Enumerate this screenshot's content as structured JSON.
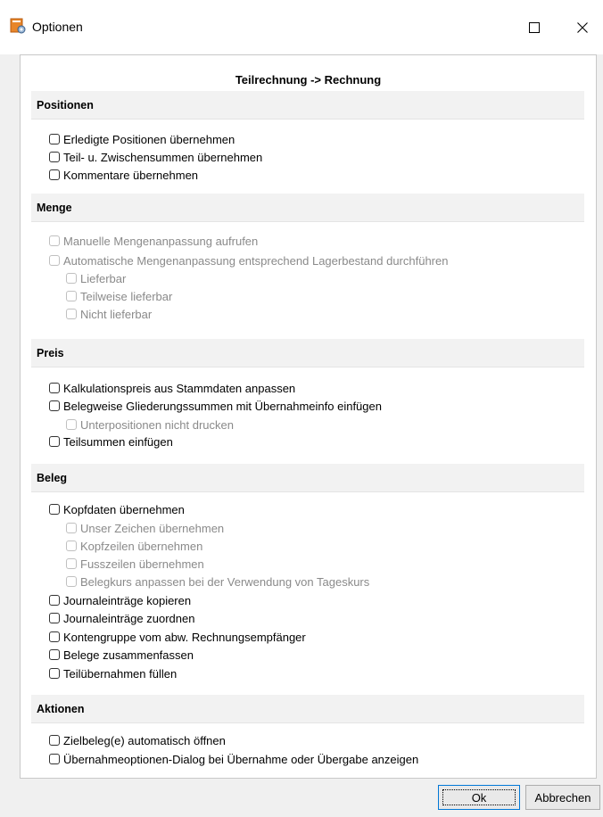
{
  "window": {
    "title": "Optionen",
    "icons": {
      "app": "options-app-icon",
      "maximize": "maximize-icon",
      "close": "close-icon"
    }
  },
  "heading": "Teilrechnung -> Rechnung",
  "sections": {
    "positionen": {
      "title": "Positionen",
      "options": [
        {
          "label": "Erledigte Positionen übernehmen",
          "checked": false,
          "enabled": true
        },
        {
          "label": "Teil- u. Zwischensummen übernehmen",
          "checked": false,
          "enabled": true
        },
        {
          "label": "Kommentare übernehmen",
          "checked": false,
          "enabled": true
        }
      ]
    },
    "menge": {
      "title": "Menge",
      "options": [
        {
          "label": "Manuelle Mengenanpassung aufrufen",
          "checked": false,
          "enabled": false
        },
        {
          "label": "Automatische Mengenanpassung entsprechend Lagerbestand durchführen",
          "checked": false,
          "enabled": false
        },
        {
          "label": "Lieferbar",
          "checked": false,
          "enabled": false
        },
        {
          "label": "Teilweise lieferbar",
          "checked": false,
          "enabled": false
        },
        {
          "label": "Nicht lieferbar",
          "checked": false,
          "enabled": false
        }
      ]
    },
    "preis": {
      "title": "Preis",
      "options": [
        {
          "label": "Kalkulationspreis aus Stammdaten anpassen",
          "checked": false,
          "enabled": true
        },
        {
          "label": "Belegweise Gliederungssummen mit Übernahmeinfo einfügen",
          "checked": false,
          "enabled": true
        },
        {
          "label": "Unterpositionen nicht drucken",
          "checked": false,
          "enabled": false
        },
        {
          "label": "Teilsummen einfügen",
          "checked": false,
          "enabled": true
        }
      ]
    },
    "beleg": {
      "title": "Beleg",
      "options": [
        {
          "label": "Kopfdaten übernehmen",
          "checked": false,
          "enabled": true
        },
        {
          "label": "Unser Zeichen übernehmen",
          "checked": false,
          "enabled": false
        },
        {
          "label": "Kopfzeilen übernehmen",
          "checked": false,
          "enabled": false
        },
        {
          "label": "Fusszeilen übernehmen",
          "checked": false,
          "enabled": false
        },
        {
          "label": "Belegkurs anpassen bei der Verwendung von Tageskurs",
          "checked": false,
          "enabled": false
        },
        {
          "label": "Journaleinträge kopieren",
          "checked": false,
          "enabled": true
        },
        {
          "label": "Journaleinträge zuordnen",
          "checked": false,
          "enabled": true
        },
        {
          "label": "Kontengruppe vom abw. Rechnungsempfänger",
          "checked": false,
          "enabled": true
        },
        {
          "label": "Belege zusammenfassen",
          "checked": false,
          "enabled": true
        },
        {
          "label": "Teilübernahmen füllen",
          "checked": false,
          "enabled": true
        }
      ]
    },
    "aktionen": {
      "title": "Aktionen",
      "options": [
        {
          "label": "Zielbeleg(e) automatisch öffnen",
          "checked": false,
          "enabled": true
        },
        {
          "label": "Übernahmeoptionen-Dialog bei Übernahme oder Übergabe anzeigen",
          "checked": false,
          "enabled": true
        }
      ]
    }
  },
  "buttons": {
    "ok": "Ok",
    "cancel": "Abbrechen"
  },
  "colors": {
    "titlebar": "#ffffff",
    "dialog": "#f0f0f0",
    "section": "#f2f2f2",
    "disabled_text": "#8a8a8a",
    "focus_border": "#0078d7"
  }
}
